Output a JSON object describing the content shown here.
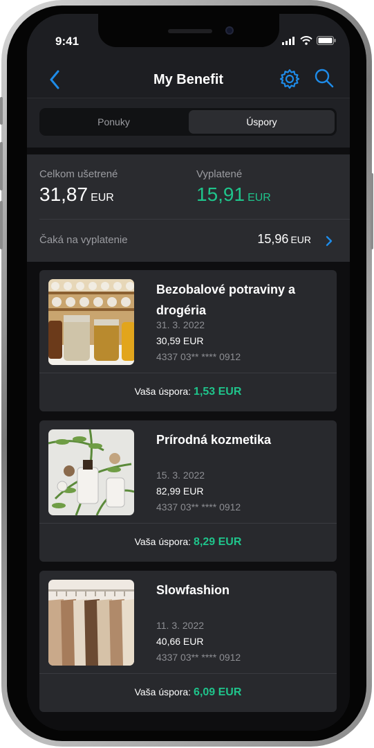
{
  "status_bar": {
    "time": "9:41"
  },
  "nav": {
    "title": "My Benefit",
    "back_icon": "chevron-left-icon",
    "settings_icon": "gear-icon",
    "search_icon": "search-icon"
  },
  "segments": {
    "left": "Ponuky",
    "right": "Úspory",
    "selected": "Úspory"
  },
  "summary": {
    "total_label": "Celkom ušetrené",
    "total_value": "31,87",
    "total_unit": "EUR",
    "paid_label": "Vyplatené",
    "paid_value": "15,91",
    "paid_unit": "EUR",
    "pending_label": "Čaká na vyplatenie",
    "pending_value": "15,96",
    "pending_unit": "EUR"
  },
  "cards": [
    {
      "title": "Bezobalové potraviny a drogéria",
      "date": "31. 3. 2022",
      "amount": "30,59 EUR",
      "card_number": "4337 03** **** 0912",
      "saving_label": "Vaša úspora:",
      "saving_value": "1,53 EUR"
    },
    {
      "title": "Prírodná kozmetika",
      "date": "15. 3. 2022",
      "amount": "82,99 EUR",
      "card_number": "4337 03** **** 0912",
      "saving_label": "Vaša úspora:",
      "saving_value": "8,29 EUR"
    },
    {
      "title": "Slowfashion",
      "date": "11. 3. 2022",
      "amount": "40,66 EUR",
      "card_number": "4337 03** **** 0912",
      "saving_label": "Vaša úspora:",
      "saving_value": "6,09 EUR"
    }
  ],
  "colors": {
    "accent": "#1e8be8",
    "positive": "#1fc48b",
    "background": "#1d1e22",
    "card": "#28292d"
  }
}
